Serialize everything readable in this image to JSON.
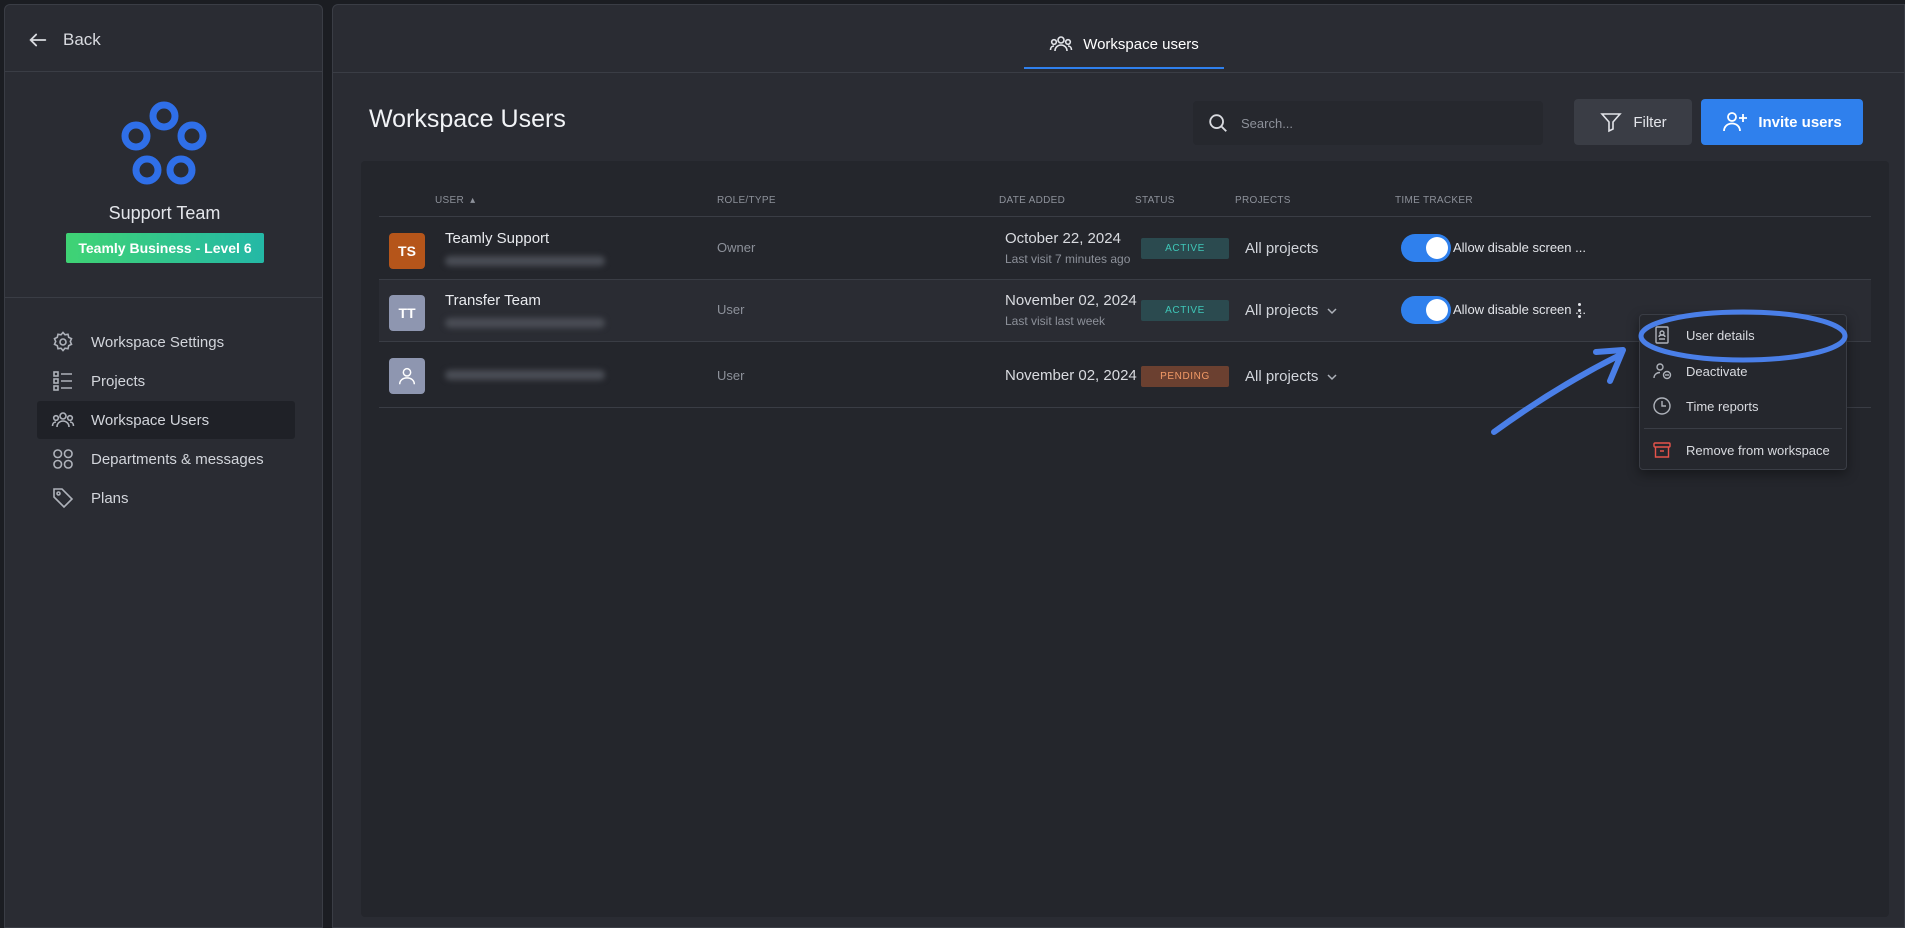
{
  "sidebar": {
    "back_label": "Back",
    "team_name": "Support Team",
    "plan_badge": "Teamly Business - Level 6",
    "nav": [
      {
        "label": "Workspace Settings",
        "icon": "gear-icon"
      },
      {
        "label": "Projects",
        "icon": "list-icon"
      },
      {
        "label": "Workspace Users",
        "icon": "users-icon",
        "active": true
      },
      {
        "label": "Departments & messages",
        "icon": "grid-icon"
      },
      {
        "label": "Plans",
        "icon": "tag-icon"
      }
    ]
  },
  "header": {
    "tab_label": "Workspace users"
  },
  "main": {
    "title": "Workspace Users",
    "search_placeholder": "Search...",
    "filter_label": "Filter",
    "invite_label": "Invite users"
  },
  "table": {
    "columns": {
      "user": "USER",
      "role": "ROLE/TYPE",
      "date": "DATE ADDED",
      "status": "STATUS",
      "projects": "PROJECTS",
      "time_tracker": "TIME TRACKER"
    },
    "rows": [
      {
        "initials": "TS",
        "avatar_color": "#b5551a",
        "name": "Teamly Support",
        "role": "Owner",
        "date": "October 22, 2024",
        "last_visit": "Last visit 7 minutes ago",
        "status": "ACTIVE",
        "projects": "All projects",
        "tracker_label": "Allow disable screen ...",
        "tracker_on": true
      },
      {
        "initials": "TT",
        "avatar_color": "#8e96b0",
        "name": "Transfer Team",
        "role": "User",
        "date": "November 02, 2024",
        "last_visit": "Last visit last week",
        "status": "ACTIVE",
        "projects": "All projects",
        "tracker_label": "Allow disable screen ...",
        "tracker_on": true
      },
      {
        "initials": "",
        "avatar_color": "#8e96b0",
        "name": "",
        "role": "User",
        "date": "November 02, 2024",
        "last_visit": "",
        "status": "PENDING",
        "projects": "All projects"
      }
    ]
  },
  "menu": {
    "items": [
      {
        "label": "User details",
        "icon": "id-card-icon"
      },
      {
        "label": "Deactivate",
        "icon": "user-minus-icon"
      },
      {
        "label": "Time reports",
        "icon": "clock-icon"
      },
      {
        "label": "Remove from workspace",
        "icon": "archive-icon"
      }
    ]
  },
  "colors": {
    "accent": "#2f80ed",
    "annotation": "#4a7fe8",
    "remove_icon": "#e5534b"
  }
}
